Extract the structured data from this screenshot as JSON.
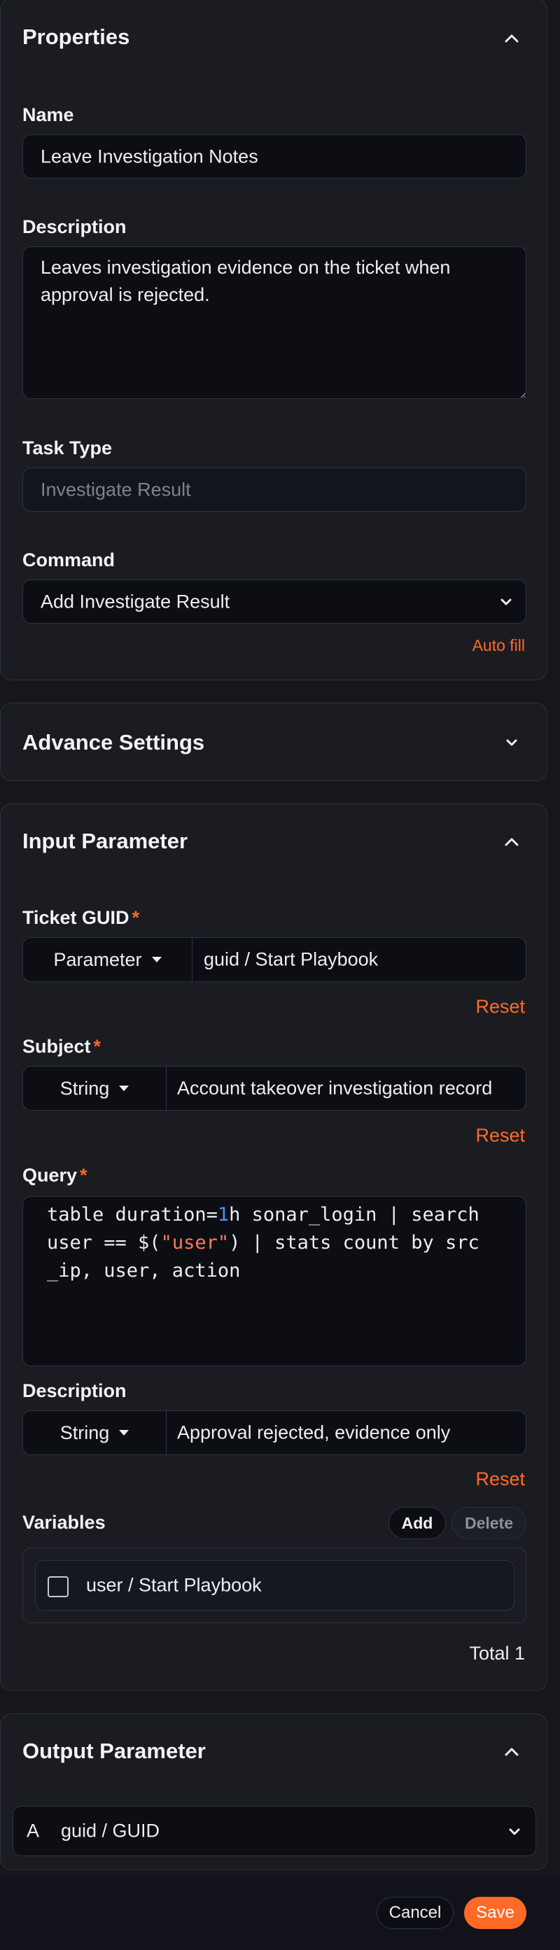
{
  "properties": {
    "title": "Properties",
    "name_label": "Name",
    "name_value": "Leave Investigation Notes",
    "description_label": "Description",
    "description_value": "Leaves investigation evidence on the ticket when approval is rejected.",
    "task_type_label": "Task Type",
    "task_type_placeholder": "Investigate Result",
    "command_label": "Command",
    "command_value": "Add Investigate Result",
    "auto_fill": "Auto fill"
  },
  "advance": {
    "title": "Advance Settings"
  },
  "input": {
    "title": "Input Parameter",
    "ticket_guid": {
      "label": "Ticket GUID",
      "required": "*",
      "type": "Parameter",
      "value": "guid / Start Playbook",
      "reset": "Reset"
    },
    "subject": {
      "label": "Subject",
      "required": "*",
      "type": "String",
      "value": "Account takeover investigation record",
      "reset": "Reset"
    },
    "query": {
      "label": "Query",
      "required": "*",
      "line1_a": "table duration=",
      "line1_num": "1",
      "line1_b": "h sonar_login | search",
      "line2_a": "user == $(",
      "line2_str": "\"user\"",
      "line2_b": ") | stats count by src",
      "line3": "_ip, user, action"
    },
    "description": {
      "label": "Description",
      "type": "String",
      "value": "Approval rejected, evidence only",
      "reset": "Reset"
    },
    "variables": {
      "label": "Variables",
      "add": "Add",
      "delete": "Delete",
      "items": [
        {
          "label": "user / Start Playbook",
          "checked": false
        }
      ],
      "total": "Total 1"
    }
  },
  "output": {
    "title": "Output Parameter",
    "item_type": "A",
    "item_value": "guid / GUID"
  },
  "footer": {
    "cancel": "Cancel",
    "save": "Save"
  },
  "colors": {
    "accent": "#ff6a26",
    "background": "#16171c",
    "panel": "#1a1c22",
    "input": "#0c0e14"
  },
  "icons": {
    "collapse": "chevron-up-icon",
    "expand": "chevron-down-icon",
    "select_caret": "caret-down-icon"
  }
}
